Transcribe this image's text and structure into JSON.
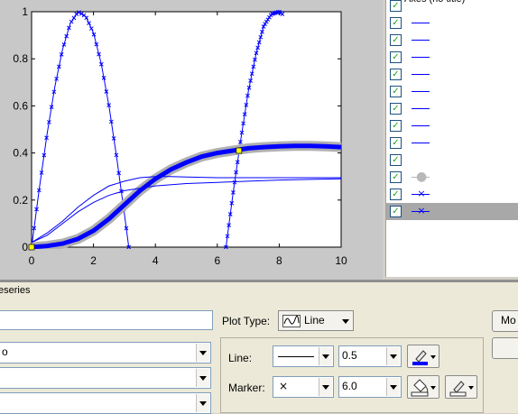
{
  "plot": {
    "x_ticks": [
      "0",
      "2",
      "4",
      "6",
      "8",
      "10"
    ],
    "y_ticks": [
      "0",
      "0.2",
      "0.4",
      "0.6",
      "0.8",
      "1"
    ],
    "background": "#c8c8c8",
    "series_color": "#0000ff",
    "selection_handle_color": "#ffff00"
  },
  "chart_data": {
    "type": "line",
    "xlim": [
      0,
      10
    ],
    "ylim": [
      0,
      1
    ],
    "grid": false,
    "series": [
      {
        "marker": "x",
        "x": [
          0,
          0.25,
          0.5,
          0.75,
          1,
          1.25,
          1.5,
          1.75,
          2,
          2.25,
          2.5,
          2.75,
          3,
          3.14
        ],
        "y": [
          0,
          0.25,
          0.48,
          0.68,
          0.84,
          0.95,
          1.0,
          0.98,
          0.91,
          0.78,
          0.6,
          0.38,
          0.14,
          0
        ]
      },
      {
        "marker": "x",
        "x": [
          6.28,
          6.5,
          6.75,
          7,
          7.25,
          7.5,
          7.75,
          8,
          8.1
        ],
        "y": [
          0,
          0.22,
          0.45,
          0.66,
          0.82,
          0.94,
          0.99,
          1.0,
          0.99
        ]
      },
      {
        "marker": "none",
        "thick": true,
        "x": [
          0,
          0.5,
          1,
          1.5,
          2,
          2.5,
          3,
          3.5,
          4,
          4.5,
          5,
          5.5,
          6,
          6.5,
          7,
          7.5,
          8,
          8.5,
          9,
          9.5,
          10
        ],
        "y": [
          0,
          0.005,
          0.015,
          0.035,
          0.07,
          0.12,
          0.18,
          0.24,
          0.29,
          0.33,
          0.36,
          0.385,
          0.4,
          0.41,
          0.42,
          0.425,
          0.428,
          0.43,
          0.43,
          0.428,
          0.425
        ]
      },
      {
        "marker": "none",
        "x": [
          0,
          0.5,
          1,
          1.5,
          2,
          2.5,
          3,
          3.5,
          4,
          5,
          6,
          7,
          8,
          9,
          10
        ],
        "y": [
          0.02,
          0.05,
          0.1,
          0.15,
          0.19,
          0.22,
          0.24,
          0.25,
          0.26,
          0.27,
          0.275,
          0.28,
          0.285,
          0.288,
          0.29
        ]
      },
      {
        "marker": "none",
        "x": [
          0,
          0.5,
          1,
          1.5,
          2,
          2.5,
          3,
          3.5,
          4,
          4.5,
          5,
          6,
          7,
          8,
          9,
          10
        ],
        "y": [
          0.02,
          0.06,
          0.11,
          0.17,
          0.22,
          0.26,
          0.28,
          0.295,
          0.3,
          0.3,
          0.298,
          0.295,
          0.295,
          0.295,
          0.295,
          0.295
        ]
      }
    ]
  },
  "plot_browser": {
    "header_label": "Axes (no title)",
    "rows": [
      {
        "kind": "header",
        "checked": true
      },
      {
        "kind": "line",
        "checked": true
      },
      {
        "kind": "line",
        "checked": true
      },
      {
        "kind": "line",
        "checked": true
      },
      {
        "kind": "line",
        "checked": true
      },
      {
        "kind": "line",
        "checked": true
      },
      {
        "kind": "line",
        "checked": true
      },
      {
        "kind": "line",
        "checked": true
      },
      {
        "kind": "line",
        "checked": true
      },
      {
        "kind": "empty",
        "checked": true
      },
      {
        "kind": "dot",
        "checked": true,
        "marker": "●"
      },
      {
        "kind": "x",
        "checked": true,
        "marker": "×"
      },
      {
        "kind": "x",
        "checked": true,
        "marker": "×",
        "selected": true
      }
    ]
  },
  "editor": {
    "title": "eseries",
    "display_name_value": "",
    "x_data_value": "o",
    "y_data_value": "",
    "z_data_value": "",
    "plot_type_label": "Plot Type:",
    "plot_type_value": "Line",
    "line_label": "Line:",
    "line_width": "0.5",
    "marker_label": "Marker:",
    "marker_value": "×",
    "marker_size": "6.0",
    "more_button_label": "Mo",
    "line_color": "#0000ff"
  }
}
